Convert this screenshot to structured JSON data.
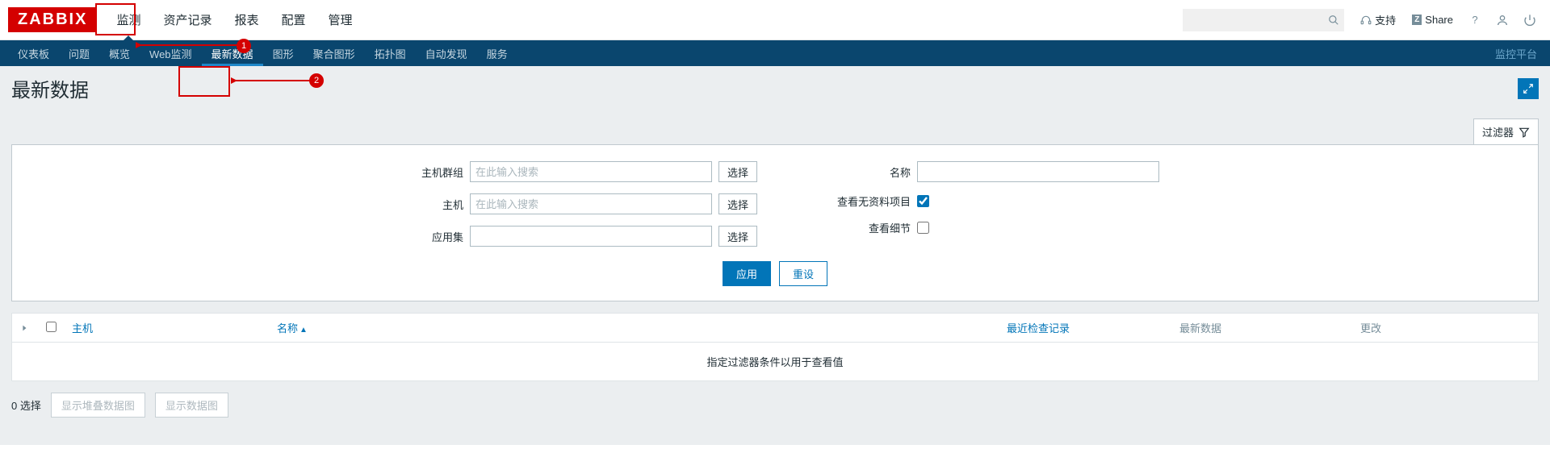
{
  "brand": "ZABBIX",
  "main_nav": {
    "items": [
      "监测",
      "资产记录",
      "报表",
      "配置",
      "管理"
    ],
    "active_index": 0
  },
  "top_right": {
    "support_label": "支持",
    "share_label": "Share",
    "share_badge": "Z"
  },
  "sub_nav": {
    "items": [
      "仪表板",
      "问题",
      "概览",
      "Web监测",
      "最新数据",
      "图形",
      "聚合图形",
      "拓扑图",
      "自动发现",
      "服务"
    ],
    "active_index": 4,
    "right_label": "监控平台"
  },
  "page_title": "最新数据",
  "filter_tab_label": "过滤器",
  "filter": {
    "hostgroup_label": "主机群组",
    "hostgroup_placeholder": "在此输入搜索",
    "host_label": "主机",
    "host_placeholder": "在此输入搜索",
    "app_label": "应用集",
    "name_label": "名称",
    "show_noinfo_label": "查看无资料项目",
    "show_noinfo_checked": true,
    "show_detail_label": "查看细节",
    "show_detail_checked": false,
    "select_btn": "选择",
    "apply_btn": "应用",
    "reset_btn": "重设"
  },
  "table": {
    "col_host": "主机",
    "col_name": "名称",
    "col_lastcheck": "最近检查记录",
    "col_lastdata": "最新数据",
    "col_change": "更改",
    "empty_message": "指定过滤器条件以用于查看值"
  },
  "footer": {
    "selected_label": "0 选择",
    "stacked_btn": "显示堆叠数据图",
    "graph_btn": "显示数据图"
  },
  "annotation": {
    "badge1": "1",
    "badge2": "2"
  }
}
